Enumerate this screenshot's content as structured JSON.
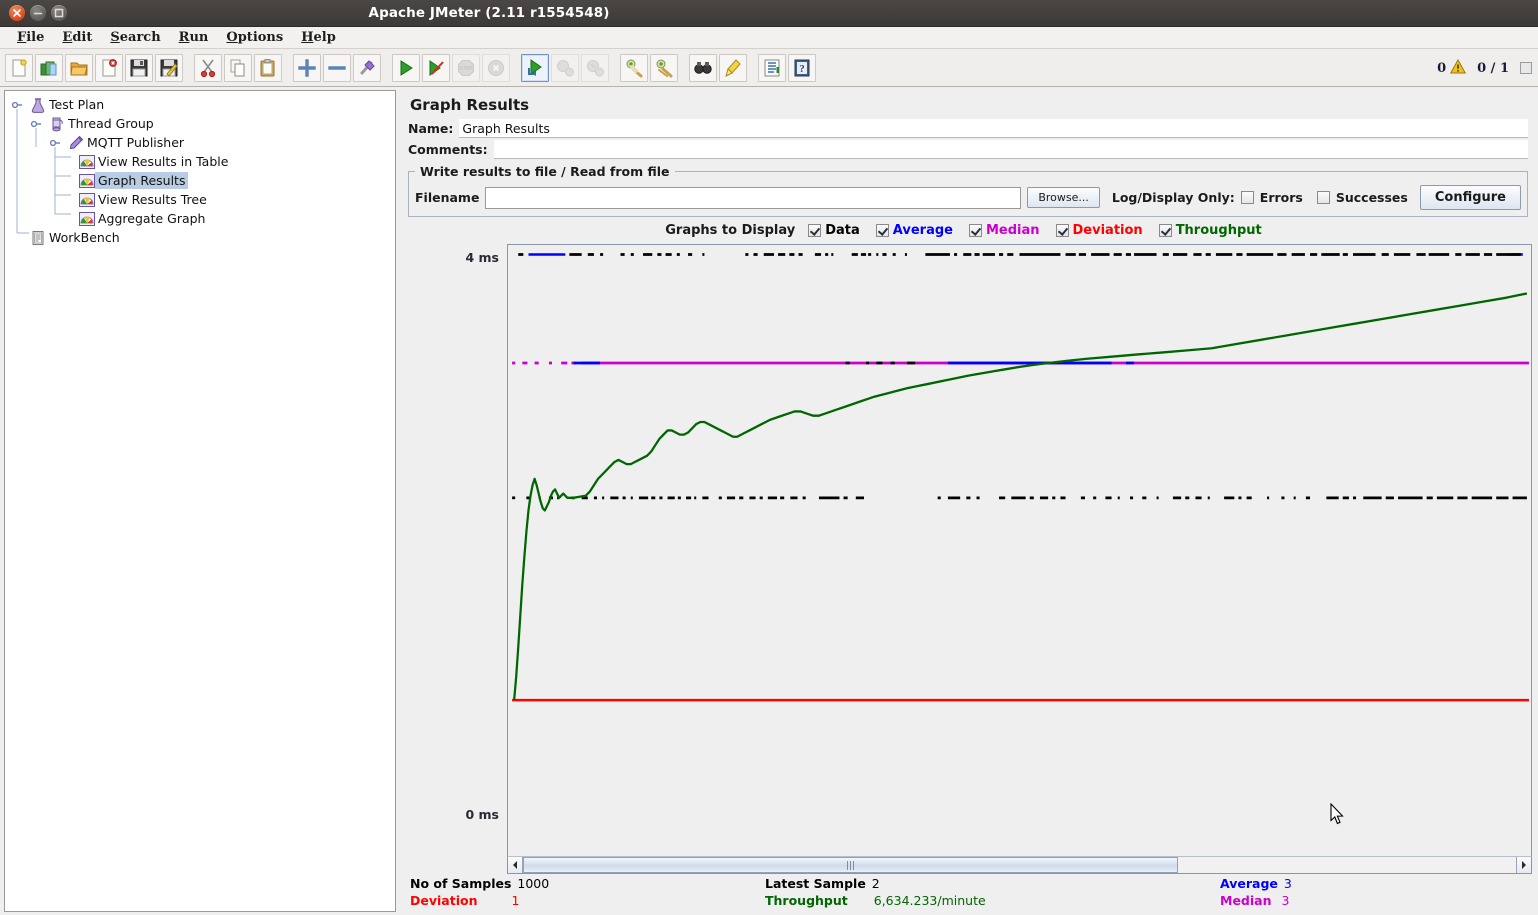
{
  "window": {
    "title": "Apache JMeter (2.11 r1554548)",
    "controls": [
      "close",
      "minimize",
      "maximize"
    ]
  },
  "menubar": {
    "items": [
      {
        "label": "File",
        "mnemonic": "F"
      },
      {
        "label": "Edit",
        "mnemonic": "E"
      },
      {
        "label": "Search",
        "mnemonic": "S"
      },
      {
        "label": "Run",
        "mnemonic": "R"
      },
      {
        "label": "Options",
        "mnemonic": "O"
      },
      {
        "label": "Help",
        "mnemonic": "H"
      }
    ]
  },
  "toolbar": {
    "buttons": [
      {
        "name": "new-icon",
        "enabled": true
      },
      {
        "name": "templates-icon",
        "enabled": true
      },
      {
        "name": "open-icon",
        "enabled": true
      },
      {
        "name": "close-icon",
        "enabled": true
      },
      {
        "name": "save-icon",
        "enabled": true
      },
      {
        "name": "save-as-icon",
        "enabled": true
      },
      {
        "name": "cut-icon",
        "enabled": true
      },
      {
        "name": "copy-icon",
        "enabled": true
      },
      {
        "name": "paste-icon",
        "enabled": true
      },
      {
        "name": "expand-all-icon",
        "enabled": true
      },
      {
        "name": "collapse-all-icon",
        "enabled": true
      },
      {
        "name": "toggle-icon",
        "enabled": true
      },
      {
        "name": "start-icon",
        "enabled": true
      },
      {
        "name": "start-no-timers-icon",
        "enabled": true
      },
      {
        "name": "stop-icon",
        "enabled": false
      },
      {
        "name": "shutdown-icon",
        "enabled": false
      },
      {
        "name": "start-remote-all-icon",
        "enabled": true,
        "selected": true
      },
      {
        "name": "stop-remote-all-icon",
        "enabled": false
      },
      {
        "name": "shutdown-remote-all-icon",
        "enabled": false
      },
      {
        "name": "clear-icon",
        "enabled": true
      },
      {
        "name": "clear-all-icon",
        "enabled": true
      },
      {
        "name": "search-icon",
        "enabled": true
      },
      {
        "name": "reset-search-icon",
        "enabled": true
      },
      {
        "name": "function-helper-icon",
        "enabled": true
      },
      {
        "name": "help-icon",
        "enabled": true
      }
    ],
    "status": {
      "warnings_count": "0",
      "warning_icon": "warning-triangle-icon",
      "threads_running": "0 / 1"
    }
  },
  "tree": {
    "nodes": [
      {
        "label": "Test Plan",
        "icon": "test-plan-icon",
        "depth": 0,
        "expanded": true,
        "selected": false
      },
      {
        "label": "Thread Group",
        "icon": "thread-group-icon",
        "depth": 1,
        "expanded": true,
        "selected": false
      },
      {
        "label": "MQTT Publisher",
        "icon": "sampler-icon",
        "depth": 2,
        "expanded": true,
        "selected": false
      },
      {
        "label": "View Results in Table",
        "icon": "listener-icon",
        "depth": 3,
        "expanded": null,
        "selected": false
      },
      {
        "label": "Graph Results",
        "icon": "listener-icon",
        "depth": 3,
        "expanded": null,
        "selected": true
      },
      {
        "label": "View Results Tree",
        "icon": "listener-icon",
        "depth": 3,
        "expanded": null,
        "selected": false
      },
      {
        "label": "Aggregate Graph",
        "icon": "listener-icon",
        "depth": 3,
        "expanded": null,
        "selected": false
      },
      {
        "label": "WorkBench",
        "icon": "workbench-icon",
        "depth": 0,
        "expanded": false,
        "selected": false
      }
    ]
  },
  "panel": {
    "title": "Graph Results",
    "name_label": "Name:",
    "name_value": "Graph Results",
    "comments_label": "Comments:",
    "comments_value": "",
    "file_group_title": "Write results to file / Read from file",
    "filename_label": "Filename",
    "filename_value": "",
    "filename_placeholder": "",
    "browse_label": "Browse...",
    "logdisplay_label": "Log/Display Only:",
    "errors_label": "Errors",
    "errors_checked": false,
    "successes_label": "Successes",
    "successes_checked": false,
    "configure_label": "Configure"
  },
  "graphs_to_display": {
    "title": "Graphs to Display",
    "options": [
      {
        "label": "Data",
        "checked": true,
        "color": "#000000"
      },
      {
        "label": "Average",
        "checked": true,
        "color": "#0000ff"
      },
      {
        "label": "Median",
        "checked": true,
        "color": "#cc00cc"
      },
      {
        "label": "Deviation",
        "checked": true,
        "color": "#ff0000"
      },
      {
        "label": "Throughput",
        "checked": true,
        "color": "#006600"
      }
    ]
  },
  "graph": {
    "y_max_label": "4 ms",
    "y_min_label": "0 ms",
    "scrollbar": {
      "left_arrow": "left-arrow-icon",
      "right_arrow": "right-arrow-icon",
      "thumb_fraction": 0.66
    }
  },
  "chart_data": {
    "type": "line",
    "title": "Graph Results",
    "xlabel": "",
    "ylabel": "ms",
    "ylim": [
      0,
      4
    ],
    "y_ticks": [
      "0 ms",
      "4 ms"
    ],
    "grid": false,
    "legend_position": "top",
    "series": [
      {
        "name": "Data",
        "color": "#000000",
        "style": "points",
        "description": "Per-sample response times, scattered mostly at 1 ms with many samples topping out at 4 ms"
      },
      {
        "name": "Average",
        "color": "#0000ff",
        "style": "line",
        "value_ms": 3,
        "description": "Flat line near 3 ms, overlapping the median line"
      },
      {
        "name": "Median",
        "color": "#cc00cc",
        "style": "line",
        "value_ms": 3,
        "description": "Flat line near 3 ms spanning full width"
      },
      {
        "name": "Deviation",
        "color": "#ff0000",
        "style": "line",
        "value_ms": 1,
        "description": "Flat line near 1 ms spanning full width"
      },
      {
        "name": "Throughput",
        "color": "#006600",
        "style": "line",
        "value": 6634.233,
        "units": "/minute",
        "description": "Rises steeply from zero at left, then climbs gradually to the right edge"
      }
    ]
  },
  "statistics": {
    "rows": [
      [
        {
          "key": "No of Samples",
          "value": "1000",
          "color": "#000000"
        },
        {
          "key": "Latest Sample",
          "value": "2",
          "color": "#000000"
        },
        {
          "key": "Average",
          "value": "3",
          "color": "#0000ff"
        }
      ],
      [
        {
          "key": "Deviation",
          "value": "1",
          "color": "#ff0000"
        },
        {
          "key": "Throughput",
          "value": "6,634.233/minute",
          "color": "#006600"
        },
        {
          "key": "Median",
          "value": "3",
          "color": "#cc00cc"
        }
      ]
    ]
  }
}
